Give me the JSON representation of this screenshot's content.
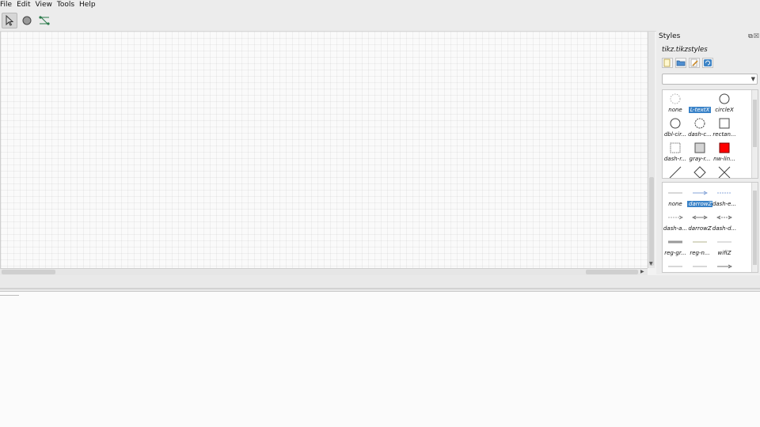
{
  "menu": [
    "File",
    "Edit",
    "View",
    "Tools",
    "Help"
  ],
  "toolbar": {
    "tools": [
      {
        "name": "select-tool-icon",
        "active": true
      },
      {
        "name": "node-tool-icon",
        "active": false
      },
      {
        "name": "edge-tool-icon",
        "active": false
      }
    ]
  },
  "styles_panel": {
    "title": "Styles",
    "file_name": "tikz.tikzstyles",
    "buttons": [
      "new-style-icon",
      "open-folder-icon",
      "edit-style-icon",
      "refresh-icon"
    ],
    "category_value": "",
    "node_styles": [
      {
        "label": "none",
        "shape": "circle-dotted",
        "selected": false
      },
      {
        "label": "L-textX",
        "shape": "blank",
        "selected": true
      },
      {
        "label": "circleX",
        "shape": "circle",
        "selected": false
      },
      {
        "label": "dbl-cir...",
        "shape": "circle",
        "selected": false
      },
      {
        "label": "dash-c...",
        "shape": "circle-dashed",
        "selected": false
      },
      {
        "label": "rectan...",
        "shape": "square",
        "selected": false
      },
      {
        "label": "dash-r...",
        "shape": "square-dashed",
        "selected": false
      },
      {
        "label": "gray-r...",
        "shape": "square-gray",
        "selected": false
      },
      {
        "label": "nw-lin...",
        "shape": "square-red",
        "selected": false
      },
      {
        "label": "",
        "shape": "line",
        "selected": false
      },
      {
        "label": "",
        "shape": "diamond",
        "selected": false
      },
      {
        "label": "",
        "shape": "cross",
        "selected": false
      }
    ],
    "edge_styles": [
      {
        "label": "none",
        "edge": "plain",
        "selected": false
      },
      {
        "label": "darrowZ",
        "edge": "arrow-blue",
        "selected": true
      },
      {
        "label": "dash-e...",
        "edge": "dashed-blue",
        "selected": false
      },
      {
        "label": "dash-a...",
        "edge": "dashed-arrow",
        "selected": false
      },
      {
        "label": "darrowZ",
        "edge": "double-arrow",
        "selected": false
      },
      {
        "label": "dash-d...",
        "edge": "dashed-double",
        "selected": false
      },
      {
        "label": "reg-gr...",
        "edge": "thick-gray",
        "selected": false
      },
      {
        "label": "reg-n...",
        "edge": "plain-olive",
        "selected": false
      },
      {
        "label": "wifiZ",
        "edge": "plain-gray",
        "selected": false
      },
      {
        "label": "",
        "edge": "plain",
        "selected": false
      },
      {
        "label": "",
        "edge": "plain",
        "selected": false
      },
      {
        "label": "",
        "edge": "arrow",
        "selected": false
      }
    ]
  },
  "colors": {
    "selection": "#3a83c8",
    "red_fill": "#ff0000",
    "gray_fill": "#d4d4d4",
    "canvas_bg": "#fafafa"
  }
}
